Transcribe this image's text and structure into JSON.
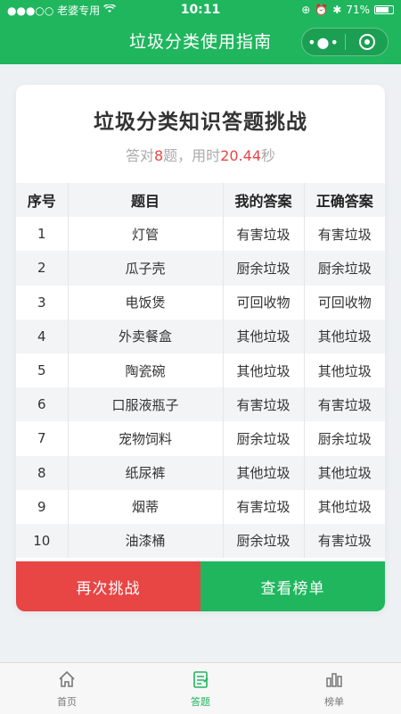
{
  "status_bar": {
    "carrier": "●●●○○ 老婆专用",
    "time": "10:11",
    "battery": "71%"
  },
  "nav": {
    "title": "垃圾分类使用指南",
    "more_label": "•●•"
  },
  "card": {
    "title": "垃圾分类知识答题挑战",
    "score": {
      "prefix": "答对",
      "correct": "8",
      "mid": "题，用时",
      "time": "20.44",
      "suffix": "秒"
    },
    "columns": [
      "序号",
      "题目",
      "我的答案",
      "正确答案"
    ],
    "rows": [
      {
        "no": "1",
        "item": "灯管",
        "mine": "有害垃圾",
        "answer": "有害垃圾"
      },
      {
        "no": "2",
        "item": "瓜子壳",
        "mine": "厨余垃圾",
        "answer": "厨余垃圾"
      },
      {
        "no": "3",
        "item": "电饭煲",
        "mine": "可回收物",
        "answer": "可回收物"
      },
      {
        "no": "4",
        "item": "外卖餐盒",
        "mine": "其他垃圾",
        "answer": "其他垃圾"
      },
      {
        "no": "5",
        "item": "陶瓷碗",
        "mine": "其他垃圾",
        "answer": "其他垃圾"
      },
      {
        "no": "6",
        "item": "口服液瓶子",
        "mine": "有害垃圾",
        "answer": "有害垃圾"
      },
      {
        "no": "7",
        "item": "宠物饲料",
        "mine": "厨余垃圾",
        "answer": "厨余垃圾"
      },
      {
        "no": "8",
        "item": "纸尿裤",
        "mine": "其他垃圾",
        "answer": "其他垃圾"
      },
      {
        "no": "9",
        "item": "烟蒂",
        "mine": "有害垃圾",
        "answer": "其他垃圾"
      },
      {
        "no": "10",
        "item": "油漆桶",
        "mine": "厨余垃圾",
        "answer": "有害垃圾"
      }
    ],
    "buttons": {
      "retry": "再次挑战",
      "rank": "查看榜单"
    }
  },
  "tabs": [
    {
      "label": "首页",
      "icon": "home-icon"
    },
    {
      "label": "答题",
      "icon": "quiz-icon"
    },
    {
      "label": "榜单",
      "icon": "ranking-icon"
    }
  ],
  "colors": {
    "brand_green": "#1fb65e",
    "alert_red": "#e84545"
  }
}
